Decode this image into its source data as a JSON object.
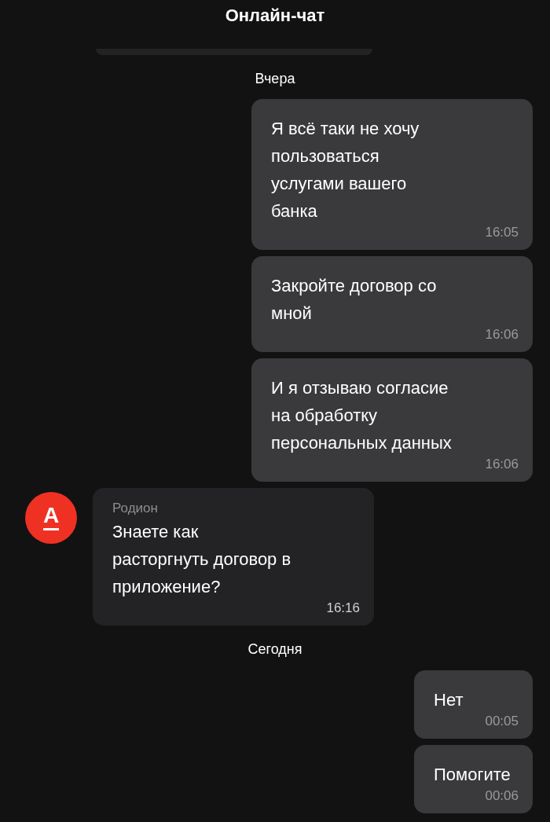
{
  "header": {
    "title": "Онлайн-чат"
  },
  "messages": [
    {
      "kind": "date",
      "text": "Вчера"
    },
    {
      "kind": "outgoing",
      "text": "Я всё таки не хочу\nпользоваться\nуслугами вашего\nбанка",
      "time": "16:05"
    },
    {
      "kind": "outgoing",
      "text": "Закройте договор со\nмной",
      "time": "16:06"
    },
    {
      "kind": "outgoing",
      "text": "И я отзываю согласие\nна обработку\nперсональных данных",
      "time": "16:06"
    },
    {
      "kind": "incoming",
      "avatar": "А",
      "sender": "Родион",
      "text": "Знаете как\nрасторгнуть договор в\nприложение?",
      "time": "16:16"
    },
    {
      "kind": "date",
      "text": "Сегодня"
    },
    {
      "kind": "outgoing",
      "text": "Нет",
      "time": "00:05"
    },
    {
      "kind": "outgoing",
      "text": "Помогите",
      "time": "00:06"
    }
  ]
}
